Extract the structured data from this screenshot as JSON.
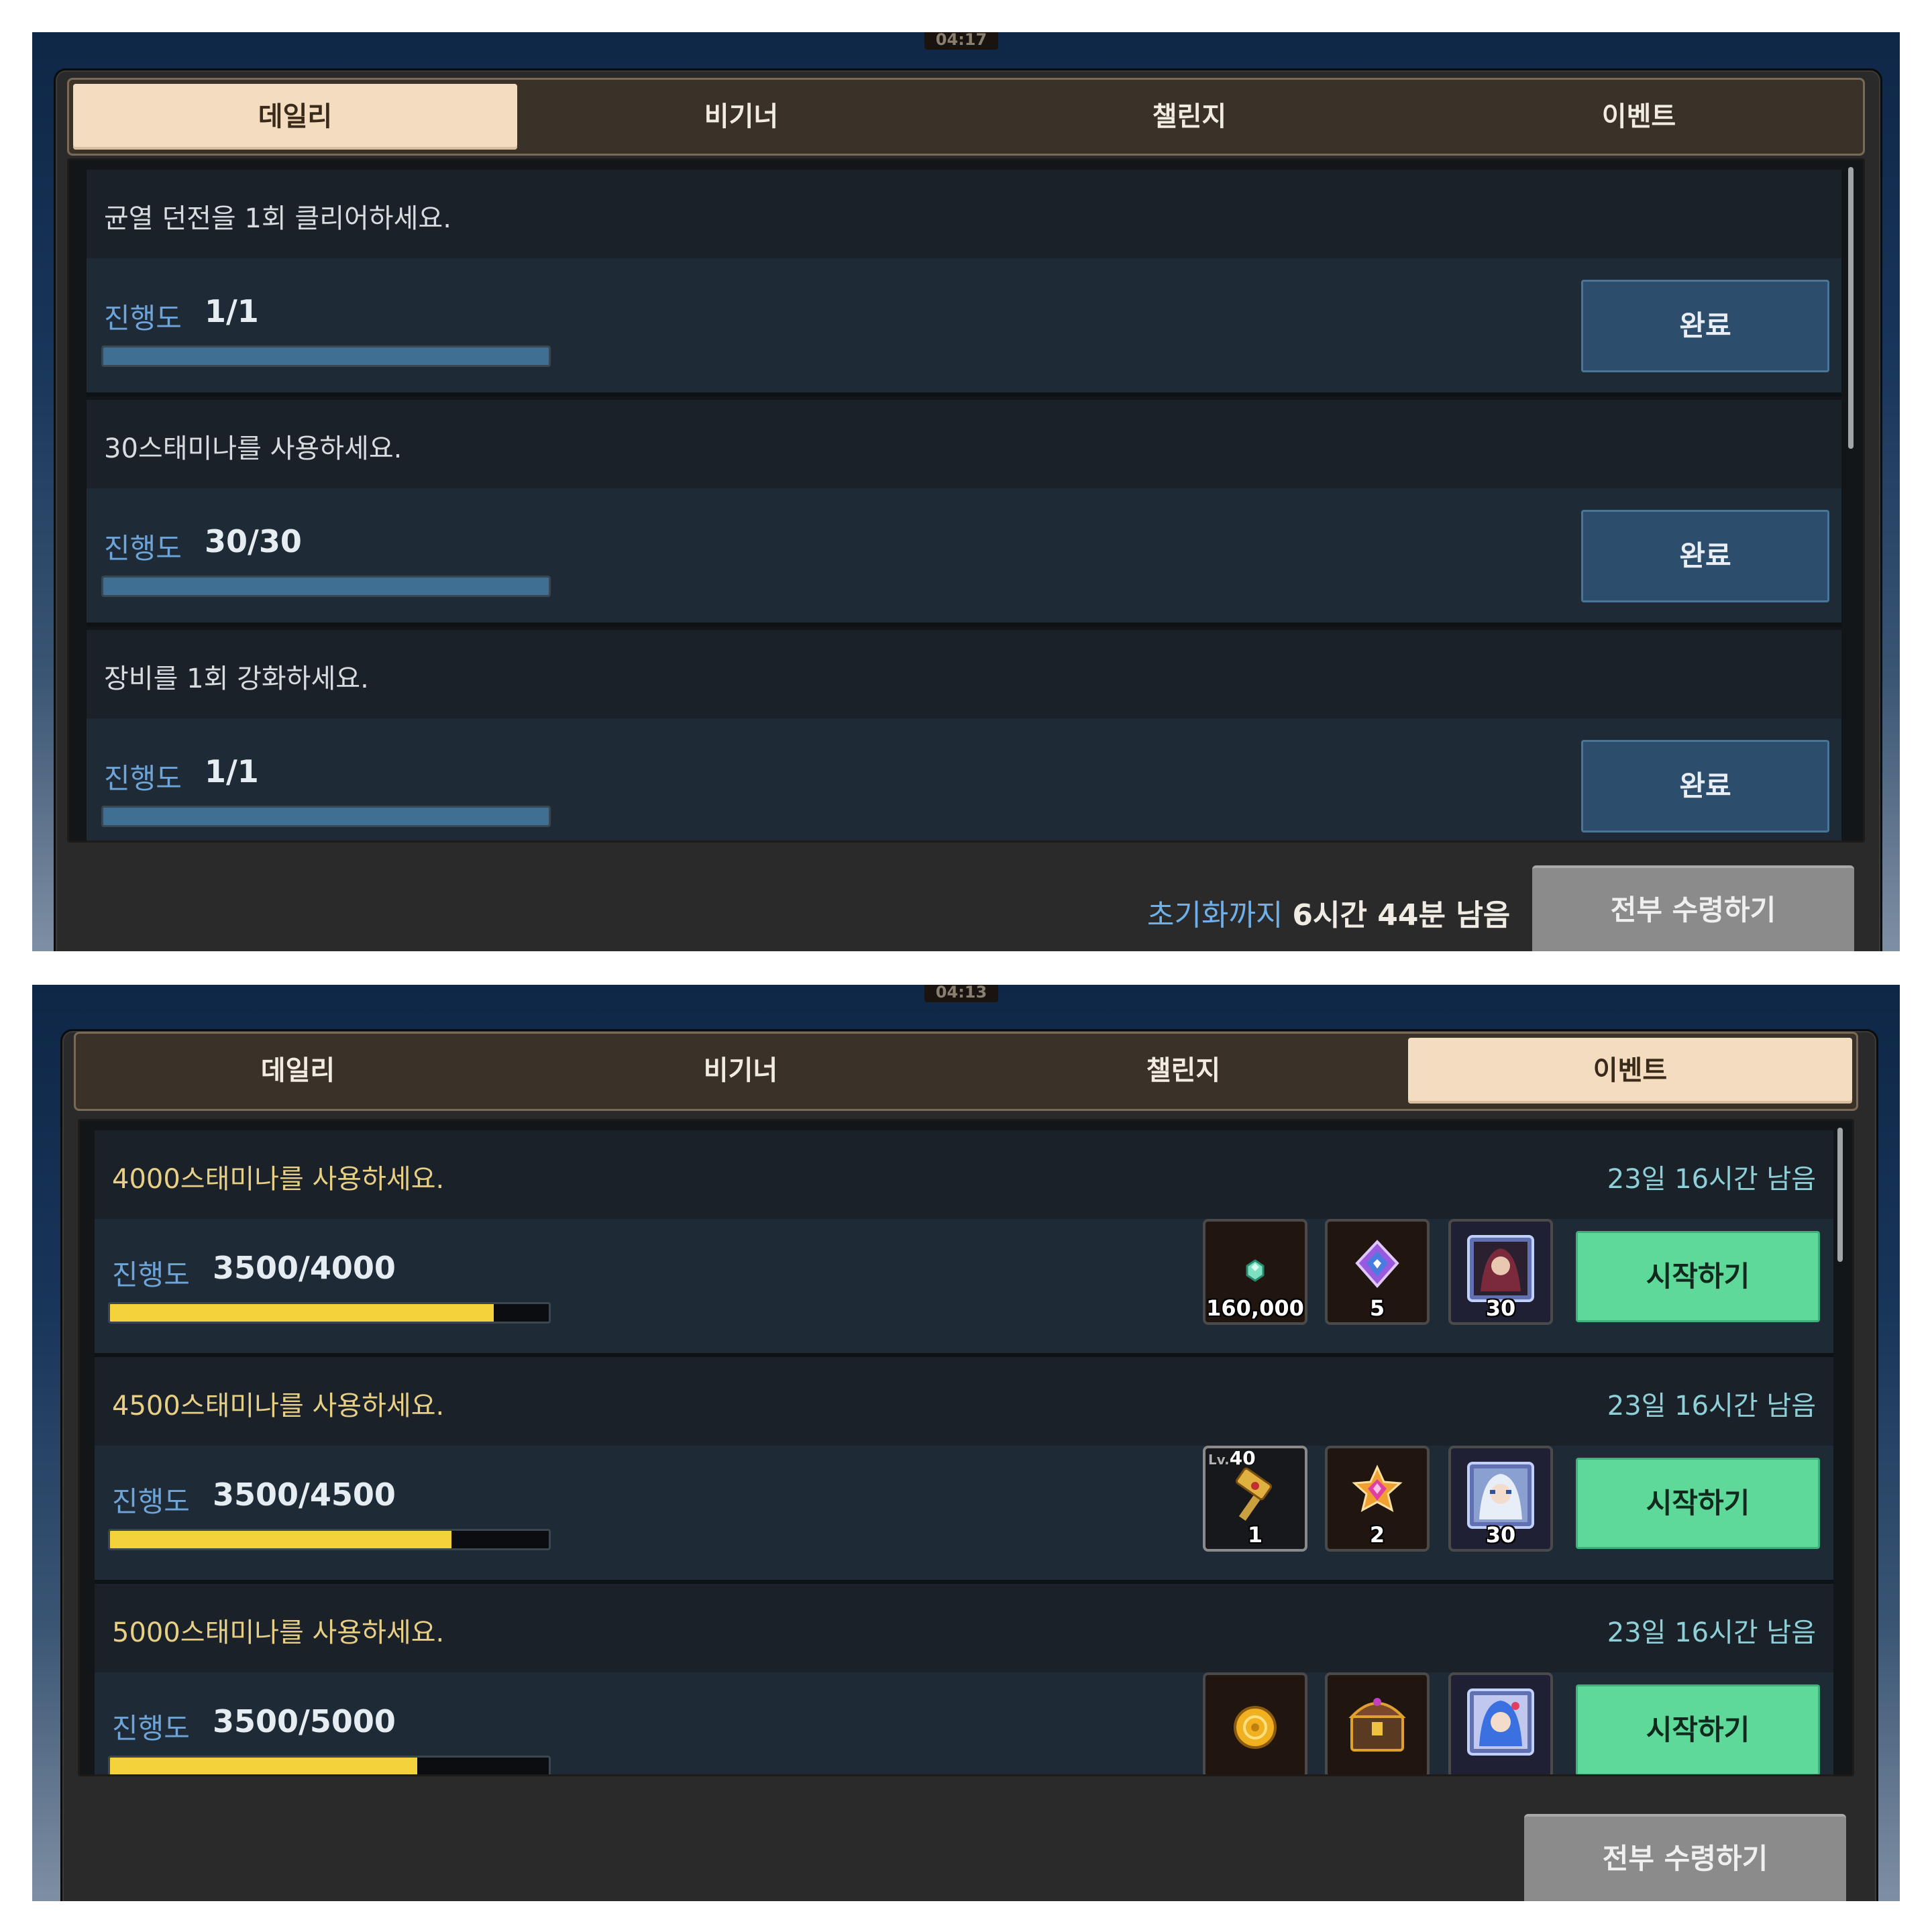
{
  "screens": [
    {
      "clock": "04:17",
      "tabs": [
        "데일리",
        "비기너",
        "챌린지",
        "이벤트"
      ],
      "active_tab": "데일리",
      "missions": [
        {
          "title": "균열 던전을 1회 클리어하세요.",
          "progress_label": "진행도",
          "progress": "1/1",
          "progress_fraction": 1.0,
          "button": "완료"
        },
        {
          "title": "30스태미나를 사용하세요.",
          "progress_label": "진행도",
          "progress": "30/30",
          "progress_fraction": 1.0,
          "button": "완료"
        },
        {
          "title": "장비를 1회 강화하세요.",
          "progress_label": "진행도",
          "progress": "1/1",
          "progress_fraction": 1.0,
          "button": "완료"
        }
      ],
      "reset_prefix": "초기화까지",
      "reset_time": "6시간 44분 남음",
      "claim_all": "전부 수령하기"
    },
    {
      "clock": "04:13",
      "tabs": [
        "데일리",
        "비기너",
        "챌린지",
        "이벤트"
      ],
      "active_tab": "이벤트",
      "missions": [
        {
          "title": "4000스태미나를 사용하세요.",
          "time_left": "23일 16시간 남음",
          "progress_label": "진행도",
          "progress": "3500/4000",
          "progress_fraction": 0.875,
          "button": "시작하기",
          "rewards": [
            {
              "icon": "crystal-gem-icon",
              "qty": "160,000"
            },
            {
              "icon": "purple-rune-icon",
              "qty": "5"
            },
            {
              "icon": "hero-portrait-dark-icon",
              "qty": "30"
            }
          ]
        },
        {
          "title": "4500스태미나를 사용하세요.",
          "time_left": "23일 16시간 남음",
          "progress_label": "진행도",
          "progress": "3500/4500",
          "progress_fraction": 0.7778,
          "button": "시작하기",
          "rewards": [
            {
              "icon": "golden-hammer-icon",
              "level_prefix": "Lv.",
              "level": "40",
              "qty": "1"
            },
            {
              "icon": "pink-gem-star-icon",
              "qty": "2"
            },
            {
              "icon": "hero-portrait-silver-icon",
              "qty": "30"
            }
          ]
        },
        {
          "title": "5000스태미나를 사용하세요.",
          "time_left": "23일 16시간 남음",
          "progress_label": "진행도",
          "progress": "3500/5000",
          "progress_fraction": 0.7,
          "button": "시작하기",
          "rewards": [
            {
              "icon": "gold-coin-icon",
              "qty": ""
            },
            {
              "icon": "treasure-chest-icon",
              "qty": ""
            },
            {
              "icon": "hero-portrait-blue-icon",
              "qty": ""
            }
          ]
        }
      ],
      "claim_all": "전부 수령하기"
    }
  ],
  "colors": {
    "active_tab_bg": "#f3dcc0",
    "complete_button": "#2c4e6c",
    "start_button": "#5fd99a",
    "event_bar_fill": "#f4d23c",
    "daily_bar_fill": "#3f6f92",
    "event_title": "#e8cf86",
    "time_left": "#8fd0d8"
  }
}
